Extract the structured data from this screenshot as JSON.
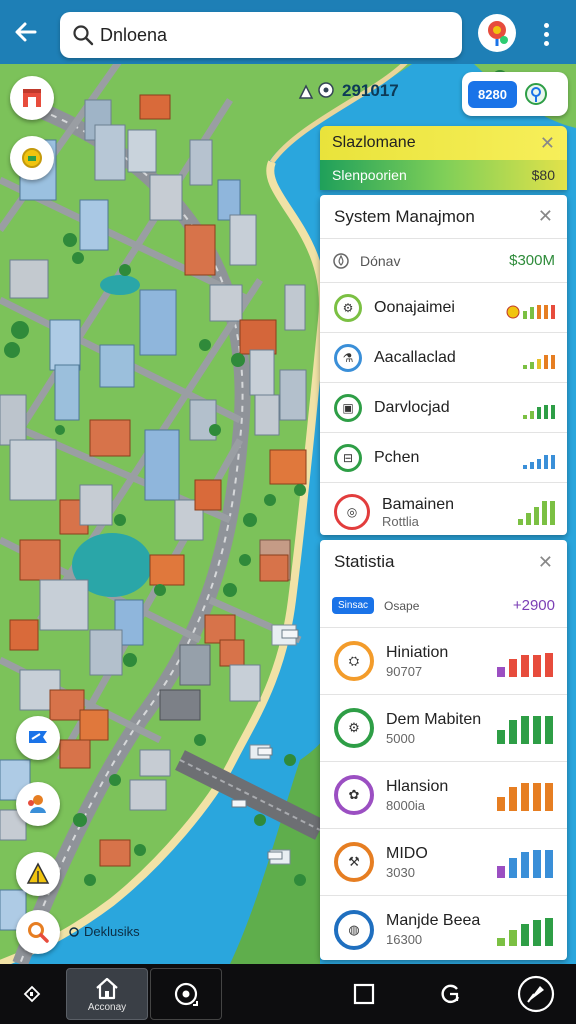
{
  "header": {
    "search_value": "Dnloena",
    "coord_text": "291017",
    "score_value": "8280"
  },
  "map": {
    "label": "Deklusiks"
  },
  "station": {
    "title": "Slazlomane",
    "subtitle": "Slenpoorien",
    "value": "$80"
  },
  "system_panel": {
    "title": "System Manajmon",
    "sub_label": "Dónav",
    "sub_value": "$300M",
    "items": [
      {
        "label": "Oonajaimei",
        "color": "#7bc043"
      },
      {
        "label": "Aacallaclad",
        "color": "#3a8fd8"
      },
      {
        "label": "Darvlocjad",
        "color": "#2e9e46"
      },
      {
        "label": "Pchen",
        "color": "#2e9e46"
      },
      {
        "label": "Bamainen",
        "sub": "Rottlia",
        "color": "#e23d3d"
      }
    ]
  },
  "stats_panel": {
    "title": "Statistia",
    "tag": "Sinsac",
    "sub_label": "Osape",
    "value": "+2900",
    "items": [
      {
        "label": "Hiniation",
        "sub": "90707",
        "color": "#f39c2b"
      },
      {
        "label": "Dem Mabiten",
        "sub": "5000",
        "color": "#2e9e46"
      },
      {
        "label": "Hlansion",
        "sub": "8000ia",
        "color": "#9b4fc2"
      },
      {
        "label": "MIDO",
        "sub": "3030",
        "color": "#e67e22"
      },
      {
        "label": "Manjde Beea",
        "sub": "16300",
        "color": "#1f6fbf"
      }
    ]
  },
  "bottom_nav": {
    "home_label": "Acconay"
  },
  "colors": {
    "topbar": "#1e7fb6",
    "water": "#2aa6dd",
    "land": "#7cc25a",
    "road": "#8f9399",
    "accent": "#1a73e8"
  }
}
